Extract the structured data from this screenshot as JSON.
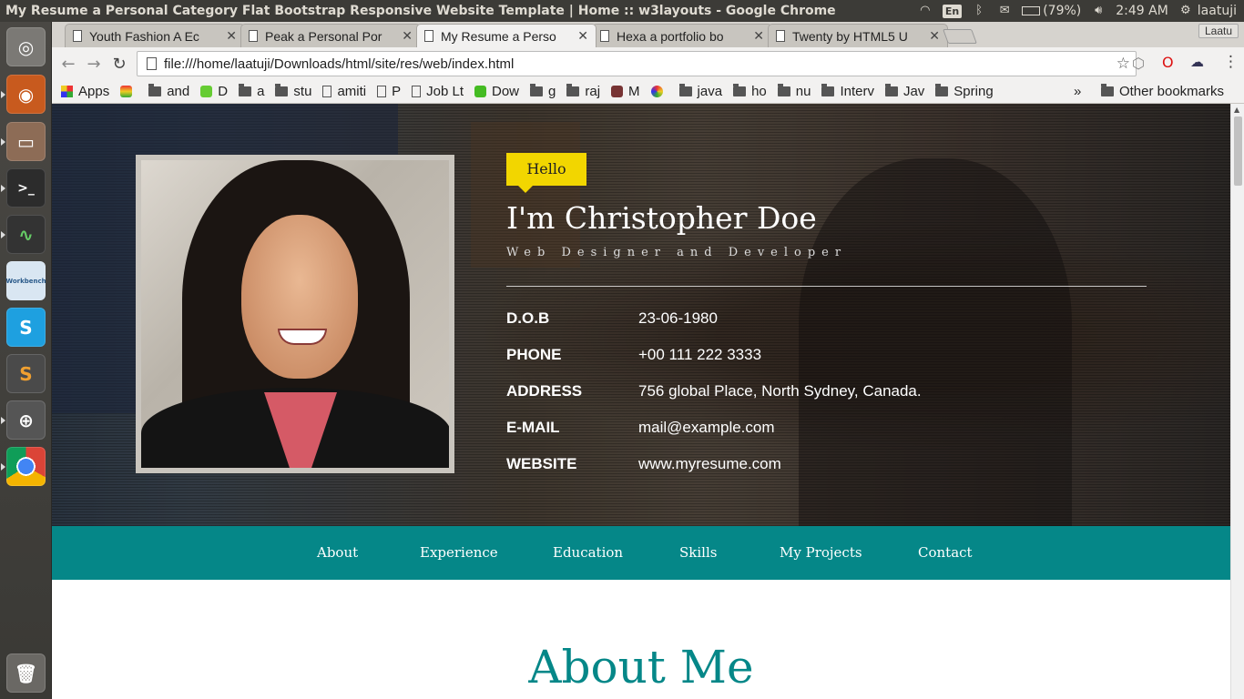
{
  "system": {
    "window_title": "My Resume a Personal Category Flat Bootstrap Responsive Website Template | Home :: w3layouts - Google Chrome",
    "lang": "En",
    "battery": "(79%)",
    "time": "2:49 AM",
    "user": "laatuji"
  },
  "launcher": {
    "items": [
      "ubuntu-dash-icon",
      "firefox-icon",
      "files-icon",
      "terminal-icon",
      "system-monitor-icon",
      "mysql-workbench-icon",
      "skype-icon",
      "sublime-text-icon",
      "software-updater-icon",
      "chrome-icon",
      "trash-icon"
    ],
    "workbench_label": "Workbench"
  },
  "browser": {
    "profile": "Laatu",
    "tabs": [
      {
        "label": "Youth Fashion A Ec"
      },
      {
        "label": "Peak a Personal Por"
      },
      {
        "label": "My Resume a Perso"
      },
      {
        "label": "Hexa a portfolio bo"
      },
      {
        "label": "Twenty by HTML5 U"
      }
    ],
    "url": "file:///home/laatuji/Downloads/html/site/res/web/index.html",
    "bookmarks": [
      {
        "label": "Apps"
      },
      {
        "label": "and"
      },
      {
        "label": "D"
      },
      {
        "label": "a"
      },
      {
        "label": "stu"
      },
      {
        "label": "amiti"
      },
      {
        "label": "P"
      },
      {
        "label": "Job Lt"
      },
      {
        "label": "Dow"
      },
      {
        "label": "g"
      },
      {
        "label": "raj"
      },
      {
        "label": "M"
      },
      {
        "label": "java"
      },
      {
        "label": "ho"
      },
      {
        "label": "nu"
      },
      {
        "label": "Interv"
      },
      {
        "label": "Jav"
      },
      {
        "label": "Spring"
      }
    ],
    "more": "»",
    "other_bookmarks": "Other bookmarks"
  },
  "page": {
    "hello": "Hello",
    "name": "I'm Christopher Doe",
    "role": "Web Designer and Developer",
    "info": [
      {
        "key": "D.O.B",
        "value": "23-06-1980"
      },
      {
        "key": "PHONE",
        "value": "+00 111 222 3333"
      },
      {
        "key": "ADDRESS",
        "value": "756 global Place, North Sydney, Canada."
      },
      {
        "key": "E-MAIL",
        "value": "mail@example.com"
      },
      {
        "key": "WEBSITE",
        "value": "www.myresume.com"
      }
    ],
    "nav": [
      "About",
      "Experience",
      "Education",
      "Skills",
      "My Projects",
      "Contact"
    ],
    "about_title": "About Me"
  },
  "colors": {
    "teal": "#058788",
    "hello_yellow": "#f2d600"
  }
}
